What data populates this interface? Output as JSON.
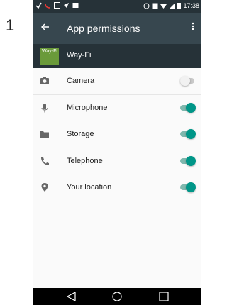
{
  "step_number": "1",
  "status_bar": {
    "time": "17:38"
  },
  "app_bar": {
    "title": "App permissions",
    "back_icon": "back-arrow-icon",
    "menu_icon": "more-vert-icon"
  },
  "app": {
    "logo_text": "Way-Fi",
    "name": "Way-Fi"
  },
  "permissions": [
    {
      "label": "Camera",
      "icon": "camera-icon",
      "enabled": false
    },
    {
      "label": "Microphone",
      "icon": "microphone-icon",
      "enabled": true
    },
    {
      "label": "Storage",
      "icon": "folder-icon",
      "enabled": true
    },
    {
      "label": "Telephone",
      "icon": "phone-icon",
      "enabled": true
    },
    {
      "label": "Your location",
      "icon": "location-pin-icon",
      "enabled": true
    }
  ],
  "colors": {
    "accent": "#009688",
    "appbar": "#37474f",
    "statusbar": "#263238"
  }
}
